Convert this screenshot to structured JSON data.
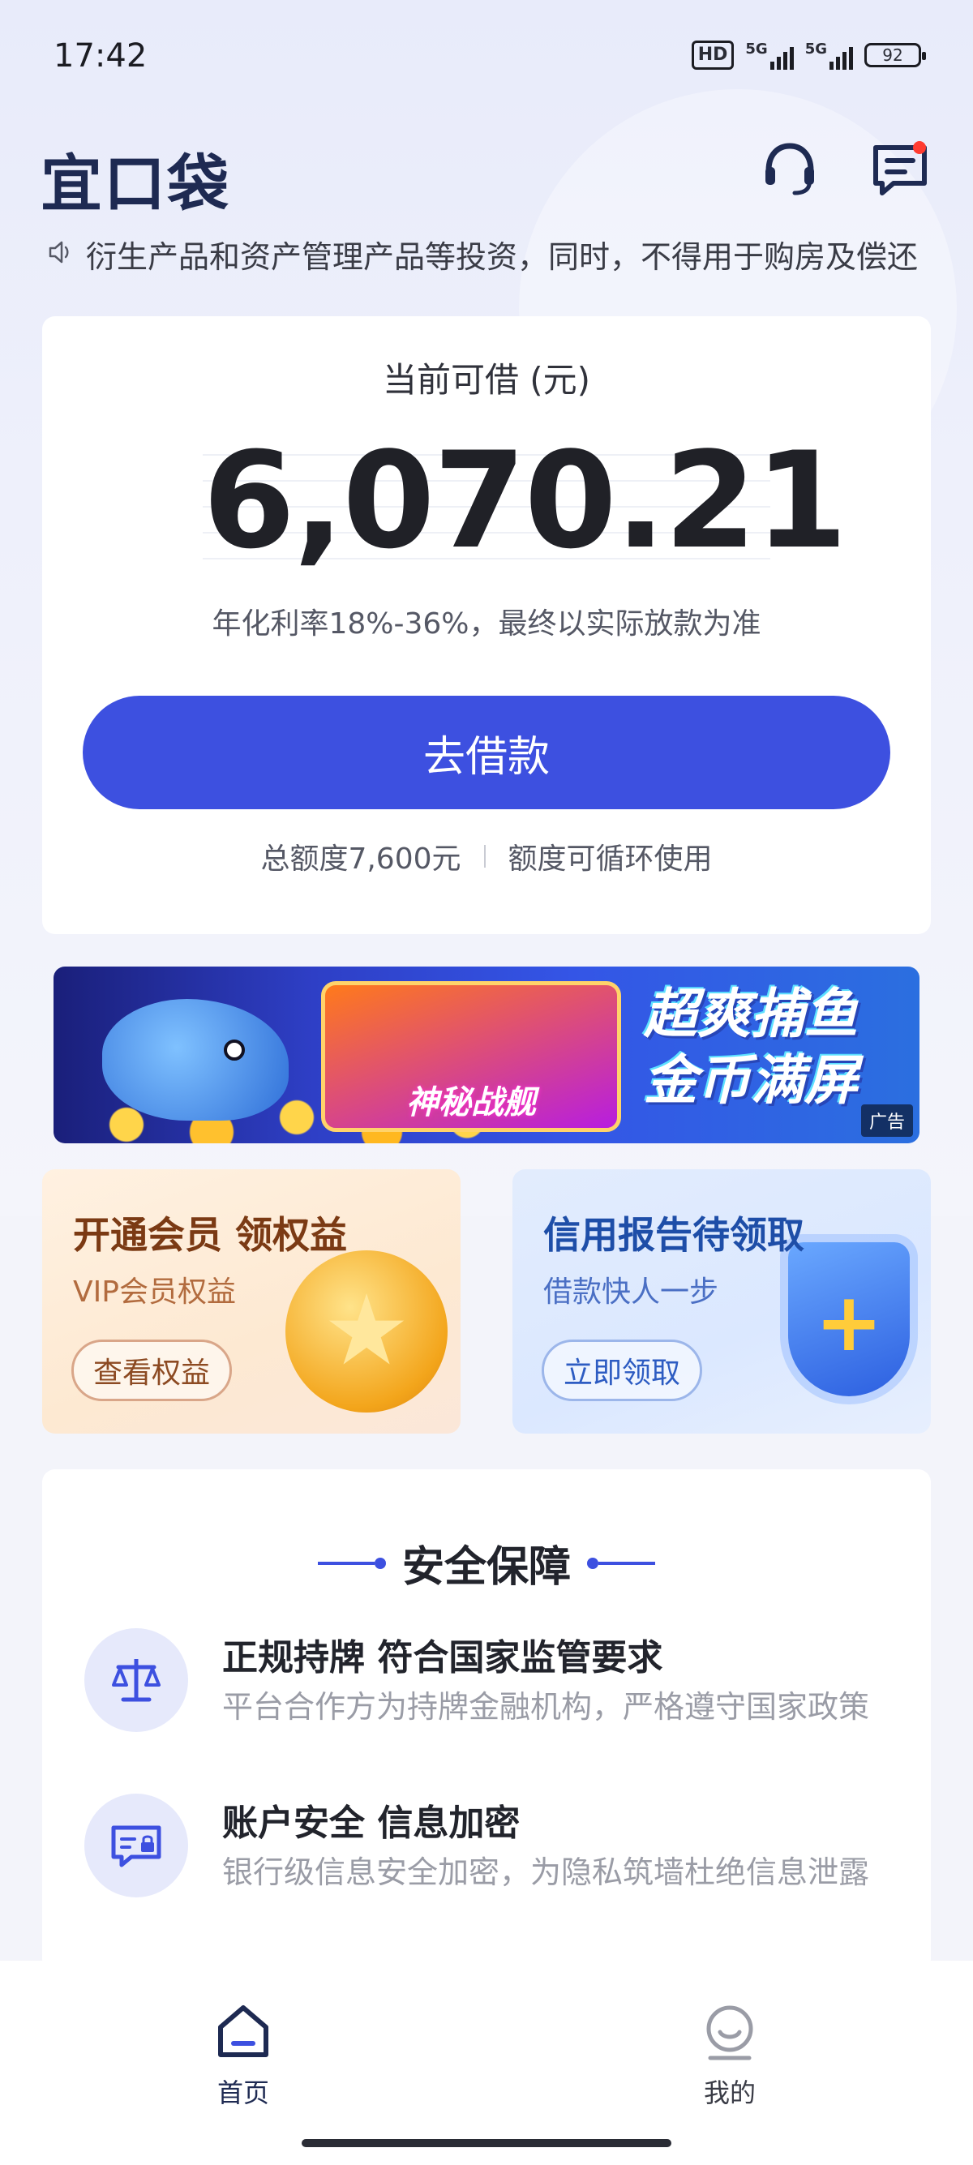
{
  "status_bar": {
    "time": "17:42",
    "hd_badge": "HD",
    "signal_1": "5G",
    "signal_2": "5G",
    "battery": "92"
  },
  "header": {
    "logo_text": "宜口袋",
    "support_icon": "headset-icon",
    "message_icon": "message-icon"
  },
  "notice": {
    "text": "衍生产品和资产管理产品等投资，同时，不得用于购房及偿还"
  },
  "loan_card": {
    "title": "当前可借 (元)",
    "amount": "6,070.21",
    "rate_note": "年化利率18%-36%，最终以实际放款为准",
    "borrow_button": "去借款",
    "total_quota": "总额度7,600元",
    "quota_note": "额度可循环使用"
  },
  "ad_banner": {
    "frame_text": "神秘战舰",
    "slogan_line1": "超爽捕鱼",
    "slogan_line2": "金币满屏",
    "ad_tag": "广告"
  },
  "promos": {
    "vip": {
      "title": "开通会员 领权益",
      "subtitle": "VIP会员权益",
      "button": "查看权益"
    },
    "credit": {
      "title": "信用报告待领取",
      "subtitle": "借款快人一步",
      "button": "立即领取"
    }
  },
  "security": {
    "title": "安全保障",
    "items": [
      {
        "title": "正规持牌 符合国家监管要求",
        "desc": "平台合作方为持牌金融机构，严格遵守国家政策",
        "icon": "scale-icon"
      },
      {
        "title": "账户安全 信息加密",
        "desc": "银行级信息安全加密，为隐私筑墙杜绝信息泄露",
        "icon": "secure-card-icon"
      }
    ]
  },
  "bottom_nav": {
    "items": [
      {
        "label": "首页",
        "icon": "home-icon",
        "active": true
      },
      {
        "label": "我的",
        "icon": "profile-icon",
        "active": false
      }
    ]
  },
  "colors": {
    "primary": "#3d50e0",
    "brand_dark": "#1e2a52",
    "notify_dot": "#ff3b30"
  }
}
